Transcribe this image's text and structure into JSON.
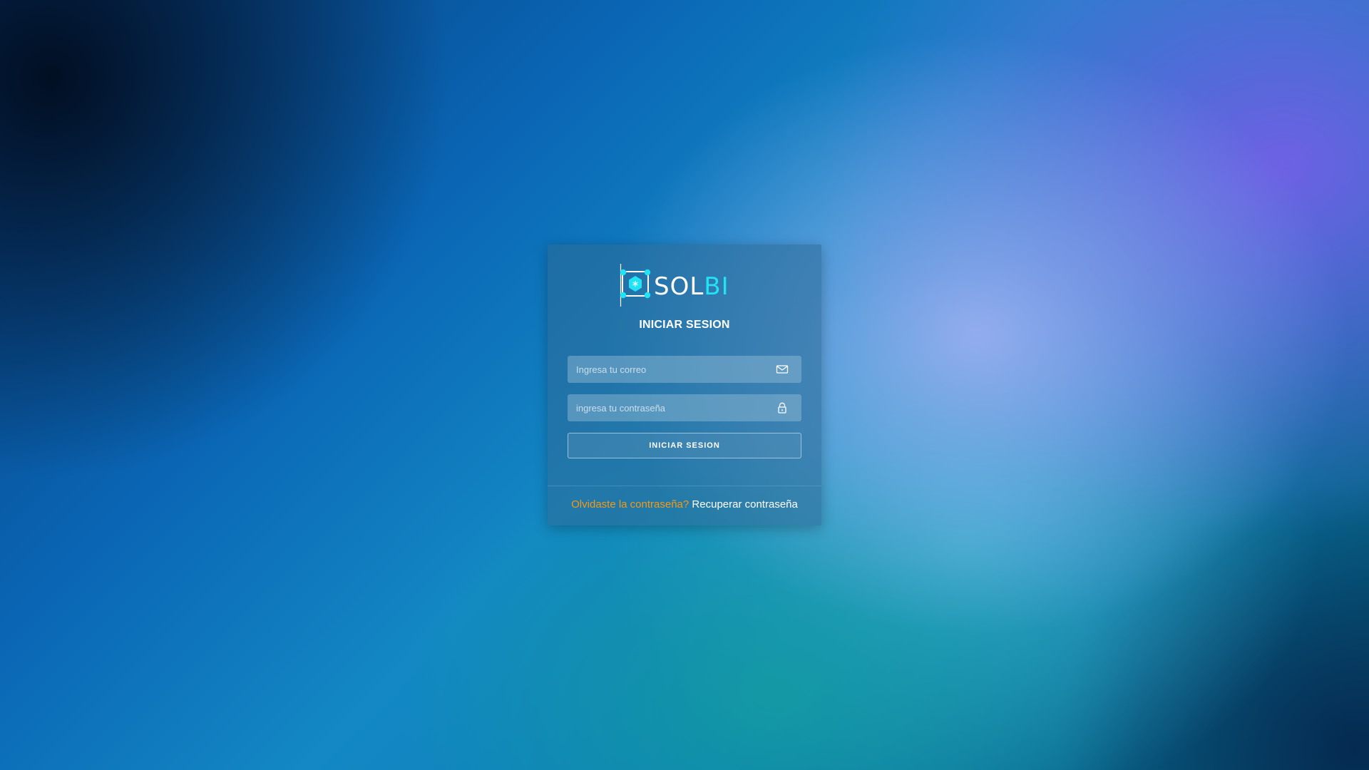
{
  "brand": {
    "logo_icon": "hexagon-node-icon",
    "name_part1": "SOL",
    "name_part2": "BI",
    "accent_color": "#22e3f3"
  },
  "login": {
    "title": "INICIAR SESION",
    "email": {
      "placeholder": "Ingresa tu correo",
      "value": "",
      "icon": "envelope-icon"
    },
    "password": {
      "placeholder": "ingresa tu contraseña",
      "value": "",
      "icon": "lock-icon"
    },
    "submit_label": "INICIAR SESION"
  },
  "footer": {
    "question": "Olvidaste la contraseña?",
    "link_label": "Recuperar contraseña",
    "question_color": "#f29a1b"
  }
}
